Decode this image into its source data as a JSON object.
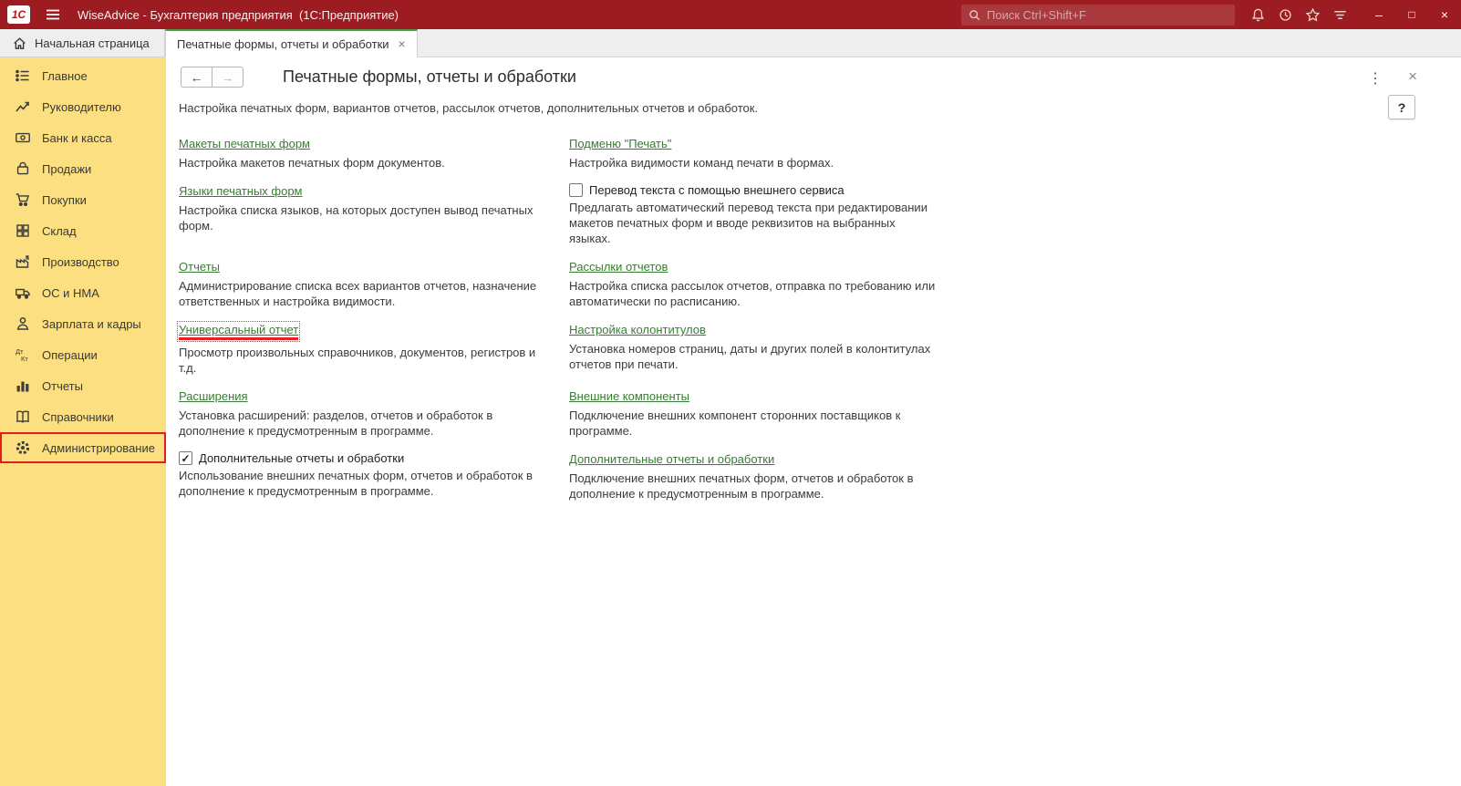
{
  "titlebar": {
    "logo": "1С",
    "title": "WiseAdvice - Бухгалтерия предприятия  (1С:Предприятие)",
    "search_placeholder": "Поиск Ctrl+Shift+F"
  },
  "icons": {
    "minimize": "–",
    "maximize": "□",
    "close": "×",
    "back": "←",
    "forward": "→",
    "more": "⋮",
    "close_form": "×",
    "tab_close": "×"
  },
  "tabs": {
    "home_label": "Начальная страница",
    "active_label": "Печатные формы, отчеты и обработки"
  },
  "sidebar": {
    "items": [
      {
        "label": "Главное"
      },
      {
        "label": "Руководителю"
      },
      {
        "label": "Банк и касса"
      },
      {
        "label": "Продажи"
      },
      {
        "label": "Покупки"
      },
      {
        "label": "Склад"
      },
      {
        "label": "Производство"
      },
      {
        "label": "ОС и НМА"
      },
      {
        "label": "Зарплата и кадры"
      },
      {
        "label": "Операции"
      },
      {
        "label": "Отчеты"
      },
      {
        "label": "Справочники"
      },
      {
        "label": "Администрирование",
        "highlighted": true
      }
    ]
  },
  "page": {
    "title": "Печатные формы, отчеты и обработки",
    "subtitle": "Настройка печатных форм, вариантов отчетов, рассылок отчетов, дополнительных отчетов и обработок.",
    "help_label": "?"
  },
  "features": {
    "left": [
      {
        "type": "link",
        "label": "Макеты печатных форм",
        "desc": "Настройка макетов печатных форм документов."
      },
      {
        "type": "link",
        "label": "Языки печатных форм",
        "desc": "Настройка списка языков, на которых доступен вывод печатных форм."
      },
      {
        "type": "link",
        "label": "Отчеты",
        "desc": "Администрирование списка всех вариантов отчетов, назначение ответственных и настройка видимости."
      },
      {
        "type": "link",
        "label": "Универсальный отчет",
        "desc": "Просмотр произвольных справочников, документов, регистров и т.д.",
        "highlighted": true
      },
      {
        "type": "link",
        "label": "Расширения",
        "desc": "Установка расширений: разделов, отчетов и обработок в дополнение к предусмотренным в программе."
      },
      {
        "type": "checkbox",
        "label": "Дополнительные отчеты и обработки",
        "checked": true,
        "desc": "Использование внешних печатных форм, отчетов и обработок в дополнение к предусмотренным в программе."
      }
    ],
    "right": [
      {
        "type": "link",
        "label": "Подменю \"Печать\"",
        "desc": "Настройка видимости команд печати в формах."
      },
      {
        "type": "checkbox",
        "label": "Перевод текста с помощью внешнего сервиса",
        "checked": false,
        "desc": "Предлагать автоматический перевод текста при редактировании макетов печатных форм и вводе реквизитов на выбранных языках."
      },
      {
        "type": "link",
        "label": "Рассылки отчетов",
        "desc": "Настройка списка рассылок отчетов, отправка по требованию или автоматически по расписанию."
      },
      {
        "type": "link",
        "label": "Настройка колонтитулов",
        "desc": "Установка номеров страниц, даты и других полей в колонтитулах отчетов при печати."
      },
      {
        "type": "link",
        "label": "Внешние компоненты",
        "desc": "Подключение внешних компонент сторонних поставщиков к программе."
      },
      {
        "type": "link",
        "label": "Дополнительные отчеты и обработки",
        "desc": "Подключение внешних печатных форм, отчетов и обработок в дополнение к предусмотренным в программе."
      }
    ]
  },
  "colors": {
    "topbar_red": "#9d1c21",
    "sidebar_yellow": "#fbdf80",
    "accent_green": "#4f9b43",
    "link_green": "#377d31",
    "annotation_red": "#e31c1c"
  }
}
